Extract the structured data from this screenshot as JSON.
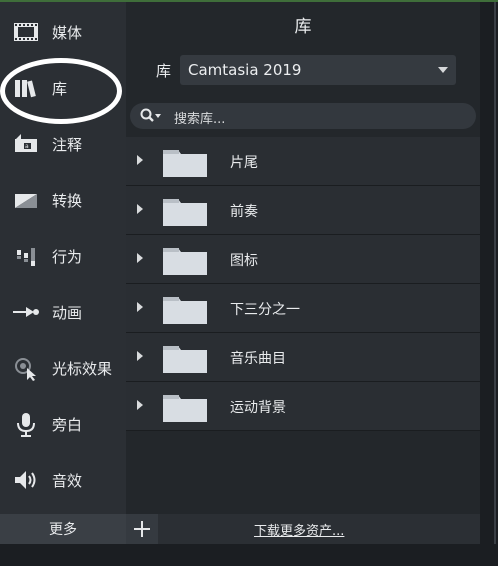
{
  "sidebar": {
    "items": [
      {
        "label": "媒体",
        "icon": "film-strip-icon"
      },
      {
        "label": "库",
        "icon": "books-icon"
      },
      {
        "label": "注释",
        "icon": "callout-icon"
      },
      {
        "label": "转换",
        "icon": "transition-icon"
      },
      {
        "label": "行为",
        "icon": "behavior-icon"
      },
      {
        "label": "动画",
        "icon": "animation-arrow-icon"
      },
      {
        "label": "光标效果",
        "icon": "cursor-effect-icon"
      },
      {
        "label": "旁白",
        "icon": "microphone-icon"
      },
      {
        "label": "音效",
        "icon": "speaker-icon"
      }
    ],
    "more_label": "更多",
    "active_index": 1
  },
  "main": {
    "title": "库",
    "library_label": "库",
    "library_select_value": "Camtasia 2019",
    "search_placeholder": "搜索库...",
    "folders": [
      {
        "name": "片尾"
      },
      {
        "name": "前奏"
      },
      {
        "name": "图标"
      },
      {
        "name": "下三分之一"
      },
      {
        "name": "音乐曲目"
      },
      {
        "name": "运动背景"
      }
    ]
  },
  "bottom": {
    "add_label": "+",
    "download_label": "下载更多资产..."
  },
  "colors": {
    "sidebar_bg": "#2b2f34",
    "panel_bg": "#23272b",
    "row_bg": "#2a2e33",
    "folder": "#d8dde3",
    "annotation": "#ffffff"
  }
}
